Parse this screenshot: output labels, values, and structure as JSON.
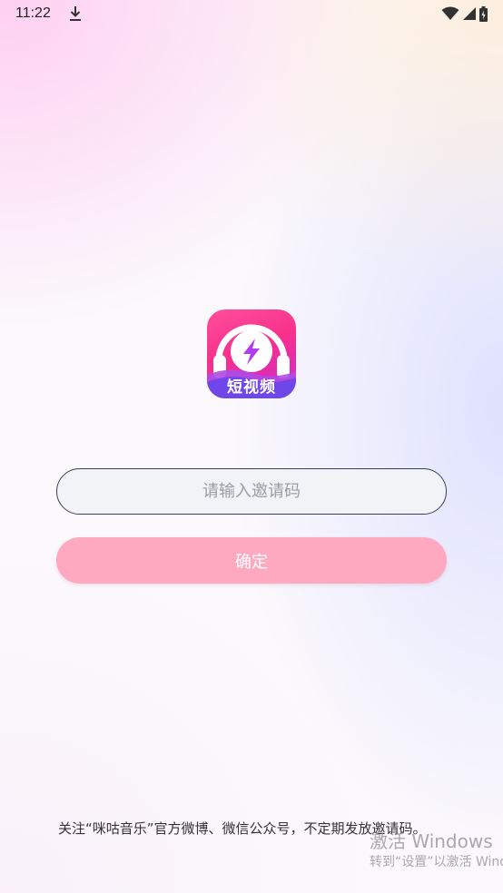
{
  "status_bar": {
    "time": "11:22",
    "icons": [
      "download-icon",
      "wifi-icon",
      "signal-icon",
      "battery-icon"
    ]
  },
  "logo": {
    "text": "短视频",
    "icon": "headphones-lightning-icon"
  },
  "invite_input": {
    "placeholder": "请输入邀请码",
    "value": ""
  },
  "confirm_button": {
    "label": "确定"
  },
  "footer": {
    "note": "关注“咪咕音乐”官方微博、微信公众号，不定期发放邀请码。"
  },
  "watermark": {
    "title": "激活 Windows",
    "subtitle": "转到“设置”以激活 Windows。"
  },
  "colors": {
    "button_bg": "#ffa9c1",
    "logo_gradient_start": "#ff4f9a",
    "logo_gradient_end": "#c928d8",
    "input_border": "#3a3f55"
  }
}
